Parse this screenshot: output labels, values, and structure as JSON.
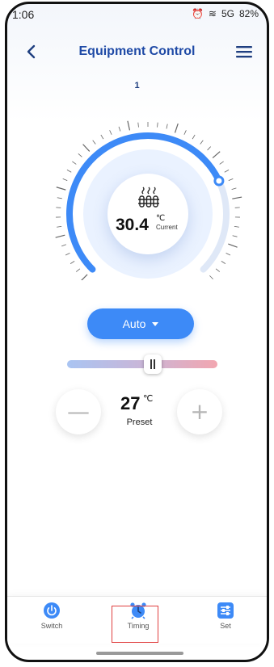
{
  "status_bar": {
    "time": "1:06",
    "battery": "82%",
    "network": "5G"
  },
  "header": {
    "title": "Equipment Control",
    "back_icon": "chevron-left-icon",
    "menu_icon": "hamburger-icon"
  },
  "device": {
    "number": "1"
  },
  "dial": {
    "current_temp": "30.4",
    "unit": "℃",
    "caption": "Current",
    "heater_icon": "heater-icon",
    "accent": "#3d8af7"
  },
  "mode": {
    "label": "Auto"
  },
  "slider": {
    "position_fraction": 0.56
  },
  "preset": {
    "value": "27",
    "unit": "℃",
    "label": "Preset",
    "minus_symbol": "—",
    "plus_symbol": "+"
  },
  "bottom_nav": {
    "items": [
      {
        "label": "Switch",
        "icon": "power-icon"
      },
      {
        "label": "Timing",
        "icon": "alarm-clock-icon"
      },
      {
        "label": "Set",
        "icon": "sliders-icon"
      }
    ],
    "active_color": "#3d8af7"
  }
}
